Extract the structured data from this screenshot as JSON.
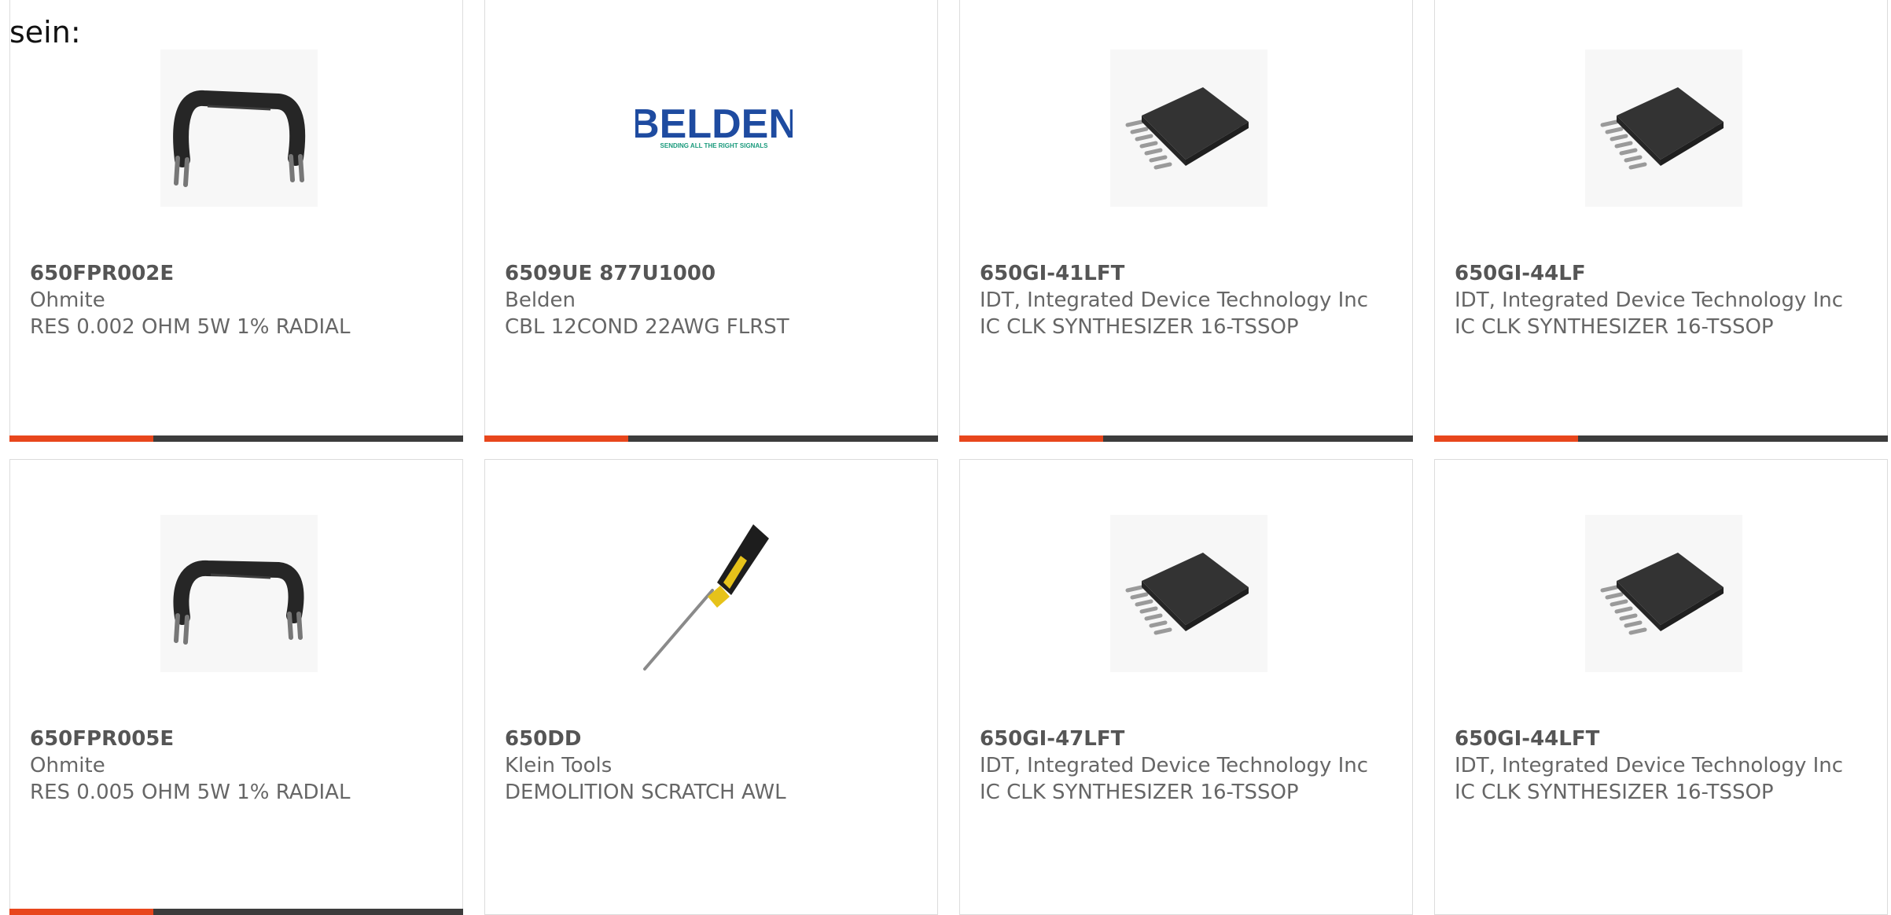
{
  "intro_text": "sein:",
  "colors": {
    "accent": "#e8461c",
    "bar": "#3c3c3c",
    "border": "#dcdcdc",
    "text": "#666666"
  },
  "products": [
    {
      "part_number": "650FPR002E",
      "manufacturer": "Ohmite",
      "description": "RES 0.002 OHM 5W 1% RADIAL",
      "image": "resistor-image"
    },
    {
      "part_number": "6509UE 877U1000",
      "manufacturer": "Belden",
      "description": "CBL 12COND 22AWG FLRST",
      "image": "belden-logo",
      "logo_text": "BELDEN",
      "logo_tagline": "SENDING ALL THE RIGHT SIGNALS"
    },
    {
      "part_number": "650GI-41LFT",
      "manufacturer": "IDT, Integrated Device Technology Inc",
      "description": "IC CLK SYNTHESIZER 16-TSSOP",
      "image": "ic-chip-image"
    },
    {
      "part_number": "650GI-44LF",
      "manufacturer": "IDT, Integrated Device Technology Inc",
      "description": "IC CLK SYNTHESIZER 16-TSSOP",
      "image": "ic-chip-image"
    },
    {
      "part_number": "650FPR005E",
      "manufacturer": "Ohmite",
      "description": "RES 0.005 OHM 5W 1% RADIAL",
      "image": "resistor-image"
    },
    {
      "part_number": "650DD",
      "manufacturer": "Klein Tools",
      "description": "DEMOLITION SCRATCH AWL",
      "image": "scratch-awl-image"
    },
    {
      "part_number": "650GI-47LFT",
      "manufacturer": "IDT, Integrated Device Technology Inc",
      "description": "IC CLK SYNTHESIZER 16-TSSOP",
      "image": "ic-chip-image"
    },
    {
      "part_number": "650GI-44LFT",
      "manufacturer": "IDT, Integrated Device Technology Inc",
      "description": "IC CLK SYNTHESIZER 16-TSSOP",
      "image": "ic-chip-image"
    }
  ]
}
